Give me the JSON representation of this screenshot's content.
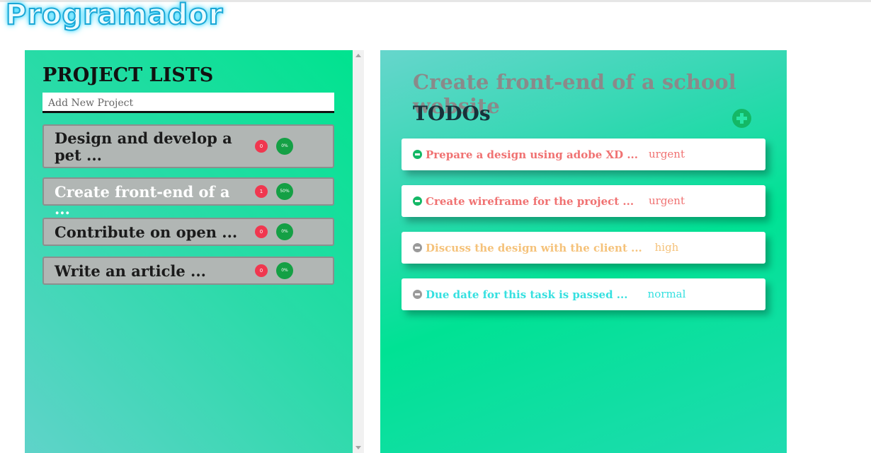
{
  "logo": {
    "text": "Programador"
  },
  "projects_panel": {
    "title": "PROJECT LISTS",
    "new_project_placeholder": "Add New Project",
    "projects": [
      {
        "name": "Design and develop a pet ...",
        "count": "0",
        "progress": "0%",
        "active": false
      },
      {
        "name": "Create front-end of a ...",
        "count": "1",
        "progress": "50%",
        "active": true
      },
      {
        "name": "Contribute on open ...",
        "count": "0",
        "progress": "0%",
        "active": false
      },
      {
        "name": "Write an article ...",
        "count": "0",
        "progress": "0%",
        "active": false
      }
    ]
  },
  "todos_panel": {
    "project_title": "Create front-end of a school website",
    "heading": "TODOs",
    "add_icon": "plus-circle-icon",
    "todos": [
      {
        "text": "Prepare a design using adobe XD ...",
        "priority": "urgent",
        "color": "#f07272",
        "icon_color": "#14b866",
        "icon": "minus-circle-icon"
      },
      {
        "text": "Create wireframe for the project ...",
        "priority": "urgent",
        "color": "#f07272",
        "icon_color": "#14b866",
        "icon": "minus-circle-icon"
      },
      {
        "text": "Discuss the design with the client ...",
        "priority": "high",
        "color": "#f5c27a",
        "icon_color": "#9a9a9a",
        "icon": "minus-circle-icon"
      },
      {
        "text": "Due date for this task is passed ...",
        "priority": "normal",
        "color": "#36e0e0",
        "icon_color": "#9a9a9a",
        "icon": "minus-circle-icon"
      }
    ]
  },
  "colors": {
    "count_badge": "#f0374f",
    "progress_badge": "#14a045",
    "project_card": "#b1b6b4"
  }
}
